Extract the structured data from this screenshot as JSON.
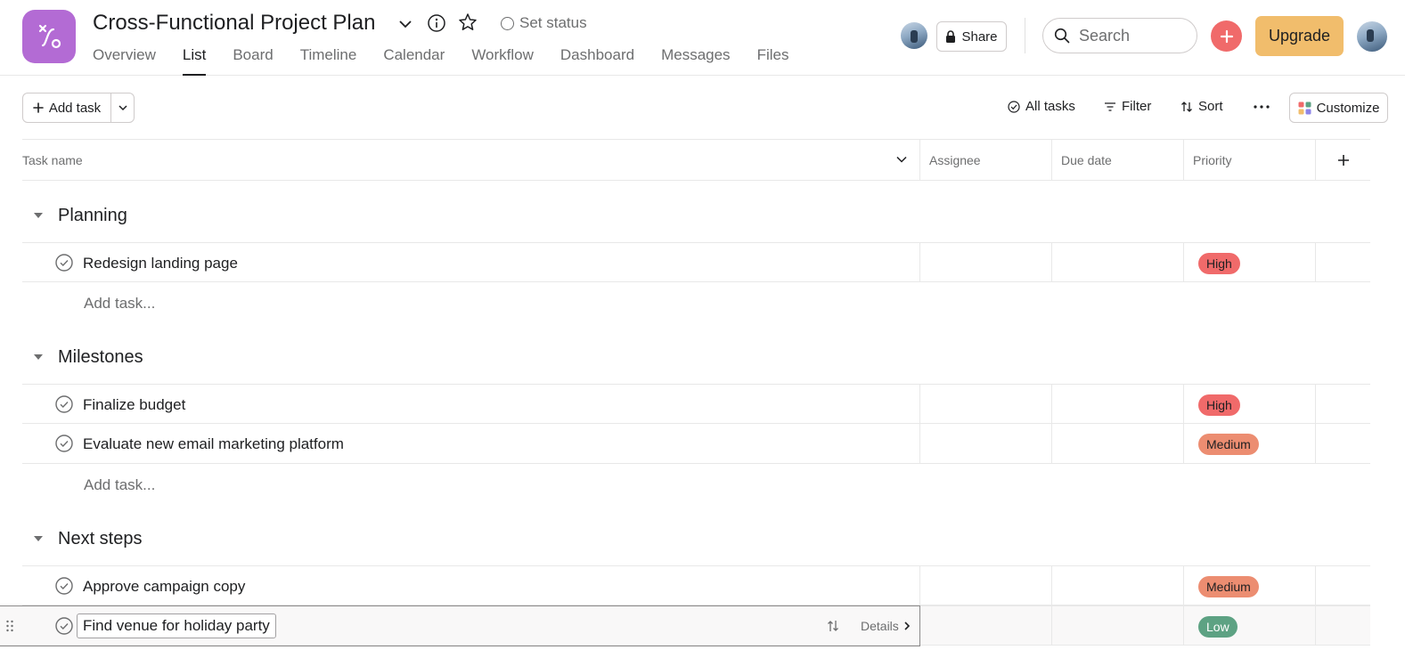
{
  "project": {
    "title": "Cross-Functional Project Plan",
    "set_status": "Set status",
    "icon_color": "#b36bd4"
  },
  "tabs": [
    {
      "label": "Overview",
      "active": false
    },
    {
      "label": "List",
      "active": true
    },
    {
      "label": "Board",
      "active": false
    },
    {
      "label": "Timeline",
      "active": false
    },
    {
      "label": "Calendar",
      "active": false
    },
    {
      "label": "Workflow",
      "active": false
    },
    {
      "label": "Dashboard",
      "active": false
    },
    {
      "label": "Messages",
      "active": false
    },
    {
      "label": "Files",
      "active": false
    }
  ],
  "topbar": {
    "share_label": "Share",
    "search_placeholder": "Search",
    "upgrade_label": "Upgrade",
    "upgrade_color": "#f1bd6c",
    "create_color": "#f06a6a"
  },
  "toolbar": {
    "add_task_label": "Add task",
    "all_tasks_label": "All tasks",
    "filter_label": "Filter",
    "sort_label": "Sort",
    "customize_label": "Customize"
  },
  "columns": {
    "task_name": "Task name",
    "assignee": "Assignee",
    "due_date": "Due date",
    "priority": "Priority"
  },
  "add_task_placeholder": "Add task...",
  "sections": [
    {
      "name": "Planning",
      "tasks": [
        {
          "name": "Redesign landing page",
          "priority": "High"
        }
      ]
    },
    {
      "name": "Milestones",
      "tasks": [
        {
          "name": "Finalize budget",
          "priority": "High"
        },
        {
          "name": "Evaluate new email marketing platform",
          "priority": "Medium"
        }
      ]
    },
    {
      "name": "Next steps",
      "tasks": [
        {
          "name": "Approve campaign copy",
          "priority": "Medium"
        },
        {
          "name": "Find venue for holiday party",
          "priority": "Low"
        }
      ]
    }
  ],
  "hover_row": {
    "details_label": "Details"
  },
  "priority_colors": {
    "High": "#f06a6a",
    "Medium": "#ec8d71",
    "Low": "#5da283"
  }
}
